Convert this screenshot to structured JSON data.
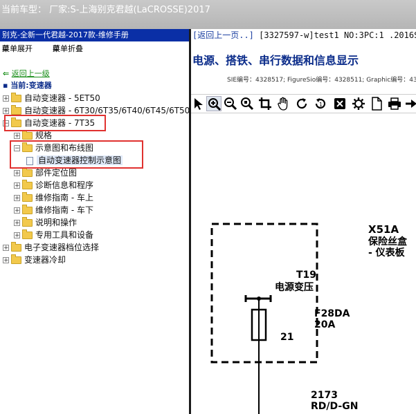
{
  "window": {
    "title": "当前车型：  厂家:S-上海别克君越(LaCROSSE)2017"
  },
  "left_panel": {
    "header": "别克-全新一代君越-2017款-维修手册",
    "menu_expand": "菜单展开",
    "menu_collapse": "菜单折叠",
    "back_link": "返回上一级",
    "current": "当前:变速器",
    "tree": [
      {
        "label": "自动变速器 - 5ET50",
        "sign": "+"
      },
      {
        "label": "自动变速器 - 6T30/6T35/6T40/6T45/6T50",
        "sign": "+"
      },
      {
        "label": "自动变速器 - 7T35",
        "sign": "−"
      },
      {
        "label": "规格",
        "sign": "+"
      },
      {
        "label": "示意图和布线图",
        "sign": "−"
      },
      {
        "label": "自动变速器控制示意图"
      },
      {
        "label": "部件定位图",
        "sign": "+"
      },
      {
        "label": "诊断信息和程序",
        "sign": "+"
      },
      {
        "label": "维修指南 - 车上",
        "sign": "+"
      },
      {
        "label": "维修指南 - 车下",
        "sign": "+"
      },
      {
        "label": "说明和操作",
        "sign": "+"
      },
      {
        "label": "专用工具和设备",
        "sign": "+"
      },
      {
        "label": "电子变速器档位选择",
        "sign": "+"
      },
      {
        "label": "变速器冷却",
        "sign": "+"
      }
    ]
  },
  "right_panel": {
    "back": "[返回上一页..]",
    "doc_info": "[3327597-w]test1 NO:3PC:1 .2016S",
    "title": "电源、搭铁、串行数据和信息显示",
    "sub": "SIE编号：4328517;  FigureSio编号：4328511;  Graphic编号：43",
    "toolbar": [
      "pointer-icon",
      "zoom-in-icon",
      "zoom-out-icon",
      "zoom-fit-icon",
      "crop-icon",
      "hand-icon",
      "rotate-icon",
      "reset-icon",
      "fit-page-icon",
      "settings-icon",
      "page-icon",
      "print-icon",
      "next-icon"
    ],
    "diagram": {
      "x51a": "X51A",
      "fuse_box": "保险丝盒",
      "panel": "- 仪表板",
      "t19": "T19",
      "transformer": "电源变压",
      "f28da": "F28DA",
      "amp": "20A",
      "pin": "21",
      "wire_no": "2173",
      "wire_color": "RD/D-GN"
    }
  }
}
